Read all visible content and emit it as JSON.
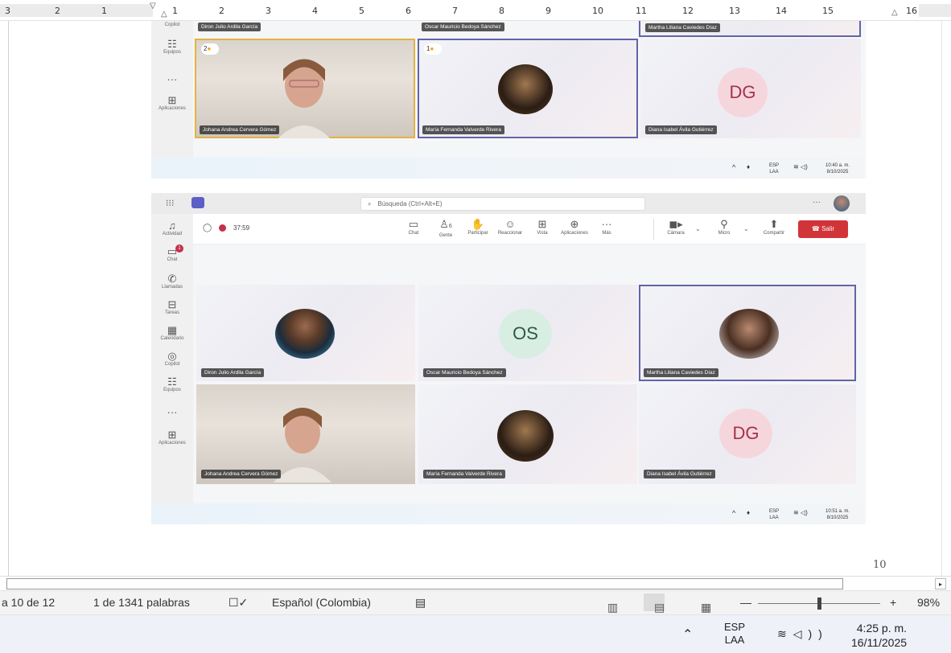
{
  "ruler": {
    "labels": [
      "3",
      "2",
      "1",
      "1",
      "2",
      "3",
      "4",
      "5",
      "6",
      "7",
      "8",
      "9",
      "10",
      "11",
      "12",
      "13",
      "14",
      "15",
      "16"
    ]
  },
  "screenshot1": {
    "rail": [
      {
        "icon": "copilot-icon",
        "label": "Copilot"
      },
      {
        "icon": "teams-icon",
        "label": "Equipos"
      },
      {
        "icon": "more-icon",
        "label": "..."
      },
      {
        "icon": "apps-icon",
        "label": "Aplicaciones"
      }
    ],
    "top_names": [
      "Diron Julio Ardila García",
      "Oscar Mauricio Bedoya Sánchez",
      "Martha Liliana Caviedes Díaz"
    ],
    "tiles": [
      {
        "name": "Johana Andrea Cervera Gómez",
        "badge": "2"
      },
      {
        "name": "María Fernanda Valverde Rivera",
        "badge": "1"
      },
      {
        "name": "Diana Isabel Ávila Gutiérrez",
        "initials": "DG"
      }
    ],
    "tray": {
      "lang1": "ESP",
      "lang2": "LAA",
      "time": "10:40 a. m.",
      "date": "8/10/2025"
    }
  },
  "screenshot2": {
    "search_placeholder": "Búsqueda (Ctrl+Alt+E)",
    "rail": [
      {
        "icon": "bell-icon",
        "label": "Actividad"
      },
      {
        "icon": "chat-icon",
        "label": "Chat"
      },
      {
        "icon": "phone-icon",
        "label": "Llamadas"
      },
      {
        "icon": "tasks-icon",
        "label": "Tareas"
      },
      {
        "icon": "calendar-icon",
        "label": "Calendario"
      },
      {
        "icon": "copilot-icon",
        "label": "Copilot"
      },
      {
        "icon": "teams-icon",
        "label": "Equipos"
      },
      {
        "icon": "more-icon",
        "label": "..."
      },
      {
        "icon": "apps-icon",
        "label": "Aplicaciones"
      }
    ],
    "chat_badge": "1",
    "timer": "37:59",
    "people_count": "6",
    "tools": [
      {
        "icon": "chat-icon",
        "label": "Chat"
      },
      {
        "icon": "people-icon",
        "label": "Gente"
      },
      {
        "icon": "hand-icon",
        "label": "Participar"
      },
      {
        "icon": "smile-icon",
        "label": "Reaccionar"
      },
      {
        "icon": "grid-icon",
        "label": "Vista"
      },
      {
        "icon": "apps-icon",
        "label": "Aplicaciones"
      },
      {
        "icon": "more-icon",
        "label": "Más"
      }
    ],
    "media": [
      {
        "icon": "camera-icon",
        "label": "Cámara"
      },
      {
        "icon": "mic-icon",
        "label": "Micro"
      },
      {
        "icon": "share-icon",
        "label": "Compartir"
      }
    ],
    "leave_label": "Salir",
    "tiles": [
      {
        "name": "Diron Julio Ardila García"
      },
      {
        "name": "Oscar Mauricio Bedoya Sánchez",
        "initials": "OS"
      },
      {
        "name": "Martha Liliana Caviedes Díaz"
      },
      {
        "name": "Johana Andrea Cervera Gómez"
      },
      {
        "name": "María Fernanda Valverde Rivera"
      },
      {
        "name": "Diana Isabel Ávila Gutiérrez",
        "initials": "DG"
      }
    ],
    "tray": {
      "lang1": "ESP",
      "lang2": "LAA",
      "time": "10:51 a. m.",
      "date": "8/10/2025"
    }
  },
  "page_number": "10",
  "statusbar": {
    "page": "a 10 de 12",
    "words": "1 de 1341 palabras",
    "language": "Español (Colombia)",
    "zoom": "98%",
    "zoom_minus": "—",
    "zoom_plus": "+"
  },
  "taskbar": {
    "lang1": "ESP",
    "lang2": "LAA",
    "time": "4:25 p. m.",
    "date": "16/11/2025"
  }
}
